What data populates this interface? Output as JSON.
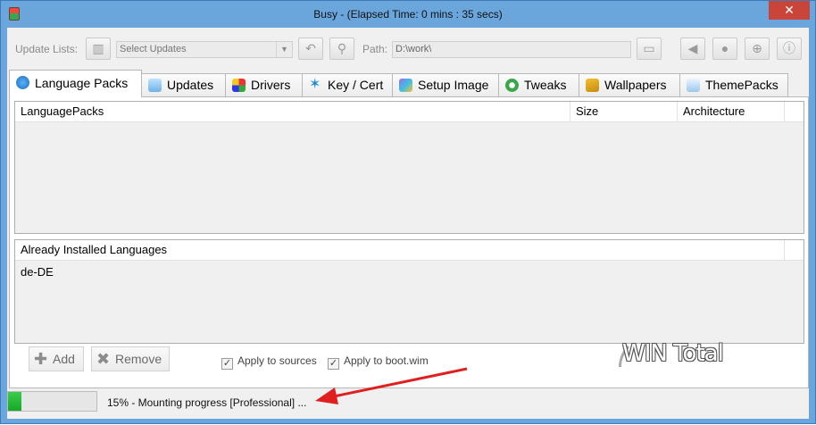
{
  "window": {
    "title": "Busy - (Elapsed Time: 0 mins : 35 secs)",
    "close_glyph": "✕"
  },
  "toolbar": {
    "update_lists_label": "Update Lists:",
    "select_value": "Select Updates",
    "path_label": "Path:",
    "path_value": "D:\\work\\"
  },
  "tabs": [
    {
      "label": "Language Packs",
      "icon": "globe-icon",
      "active": true
    },
    {
      "label": "Updates",
      "icon": "updates-icon"
    },
    {
      "label": "Drivers",
      "icon": "drivers-icon"
    },
    {
      "label": "Key / Cert",
      "icon": "key-cert-icon"
    },
    {
      "label": "Setup Image",
      "icon": "setup-image-icon"
    },
    {
      "label": "Tweaks",
      "icon": "tweaks-icon"
    },
    {
      "label": "Wallpapers",
      "icon": "wallpapers-icon"
    },
    {
      "label": "ThemePacks",
      "icon": "themepacks-icon"
    }
  ],
  "language_packs_table": {
    "columns": [
      "LanguagePacks",
      "Size",
      "Architecture"
    ],
    "rows": []
  },
  "installed_table": {
    "header": "Already Installed Languages",
    "rows": [
      "de-DE"
    ]
  },
  "actions": {
    "add_label": "Add",
    "remove_label": "Remove",
    "apply_sources_label": "Apply to sources",
    "apply_sources_checked": true,
    "apply_bootwim_label": "Apply to boot.wim",
    "apply_bootwim_checked": true
  },
  "watermark": {
    "text": "WIN Total"
  },
  "status": {
    "progress_percent": 15,
    "text": "15% - Mounting progress [Professional] ..."
  },
  "colors": {
    "titlebar": "#6aa6dc",
    "close": "#c9453a",
    "progress": "#2bbf3a",
    "annotation_arrow": "#e02020"
  }
}
